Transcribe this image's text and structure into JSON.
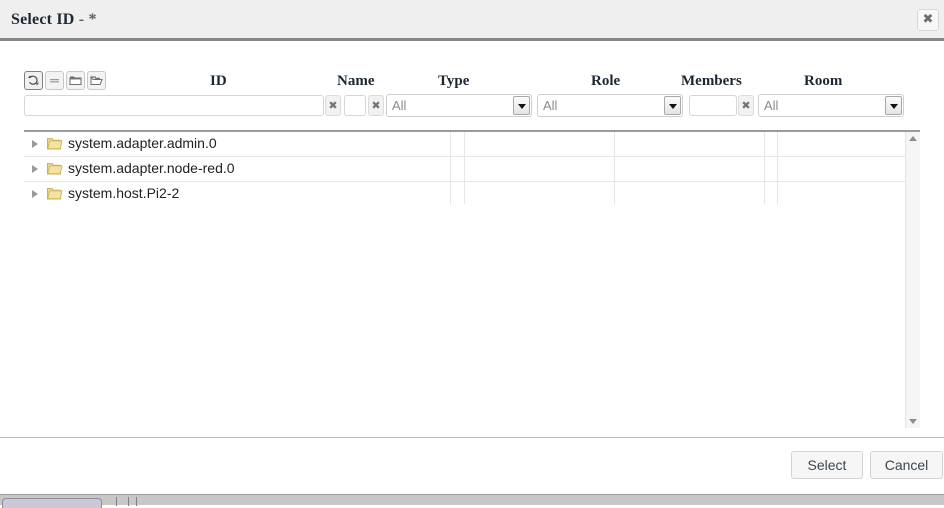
{
  "dialog": {
    "title_main": "Select ID",
    "title_sep": " - ",
    "title_filter": "*",
    "close_icon": "✖"
  },
  "toolbar": {
    "buttons": [
      {
        "name": "refresh-icon",
        "label": "Refresh",
        "active": true
      },
      {
        "name": "list-icon",
        "label": "Flat list",
        "active": false
      },
      {
        "name": "collapse-all-icon",
        "label": "Collapse all",
        "active": false
      },
      {
        "name": "expand-all-icon",
        "label": "Expand all",
        "active": false
      }
    ]
  },
  "columns": {
    "id": "ID",
    "name": "Name",
    "type": "Type",
    "role": "Role",
    "members": "Members",
    "room": "Room"
  },
  "filters": {
    "id_value": "",
    "id_placeholder": "",
    "id_clear_icon": "✖",
    "name_value": "",
    "name_placeholder": "",
    "name_clear_icon": "✖",
    "type_selected": "All",
    "type_options": [
      "All"
    ],
    "role_selected": "All",
    "role_options": [
      "All"
    ],
    "members_value": "",
    "members_placeholder": "",
    "members_clear_icon": "✖",
    "room_selected": "All",
    "room_options": [
      "All"
    ]
  },
  "tree": {
    "rows": [
      {
        "id": "system.adapter.admin.0",
        "name": "",
        "type": "",
        "role": "",
        "members": "",
        "room": "",
        "expanded": false
      },
      {
        "id": "system.adapter.node-red.0",
        "name": "",
        "type": "",
        "role": "",
        "members": "",
        "room": "",
        "expanded": false
      },
      {
        "id": "system.host.Pi2-2",
        "name": "",
        "type": "",
        "role": "",
        "members": "",
        "room": "",
        "expanded": false
      }
    ]
  },
  "scrollbar": {
    "up_icon": "▲",
    "down_icon": "▼"
  },
  "footer": {
    "select_label": "Select",
    "cancel_label": "Cancel"
  },
  "colors": {
    "titlebar_bg": "#efefef",
    "folder": "#e8d27a",
    "accent_border": "#9b9b9b"
  }
}
